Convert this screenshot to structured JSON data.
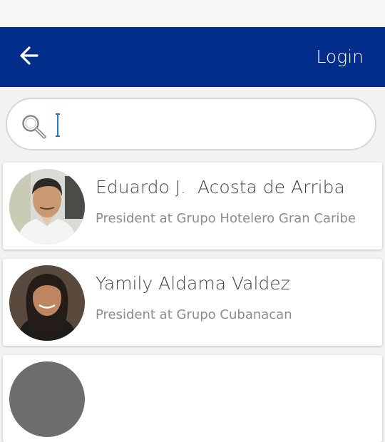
{
  "header": {
    "back_icon": "arrow-left-icon",
    "login_label": "Login",
    "bar_color": "#032d8a"
  },
  "search": {
    "icon": "search-icon",
    "value": "",
    "placeholder": ""
  },
  "people": [
    {
      "name": "Eduardo J.  Acosta de Arriba",
      "role": "President at Grupo Hotelero Gran Caribe"
    },
    {
      "name": "Yamily Aldama Valdez",
      "role": "President at Grupo Cubanacan"
    }
  ]
}
